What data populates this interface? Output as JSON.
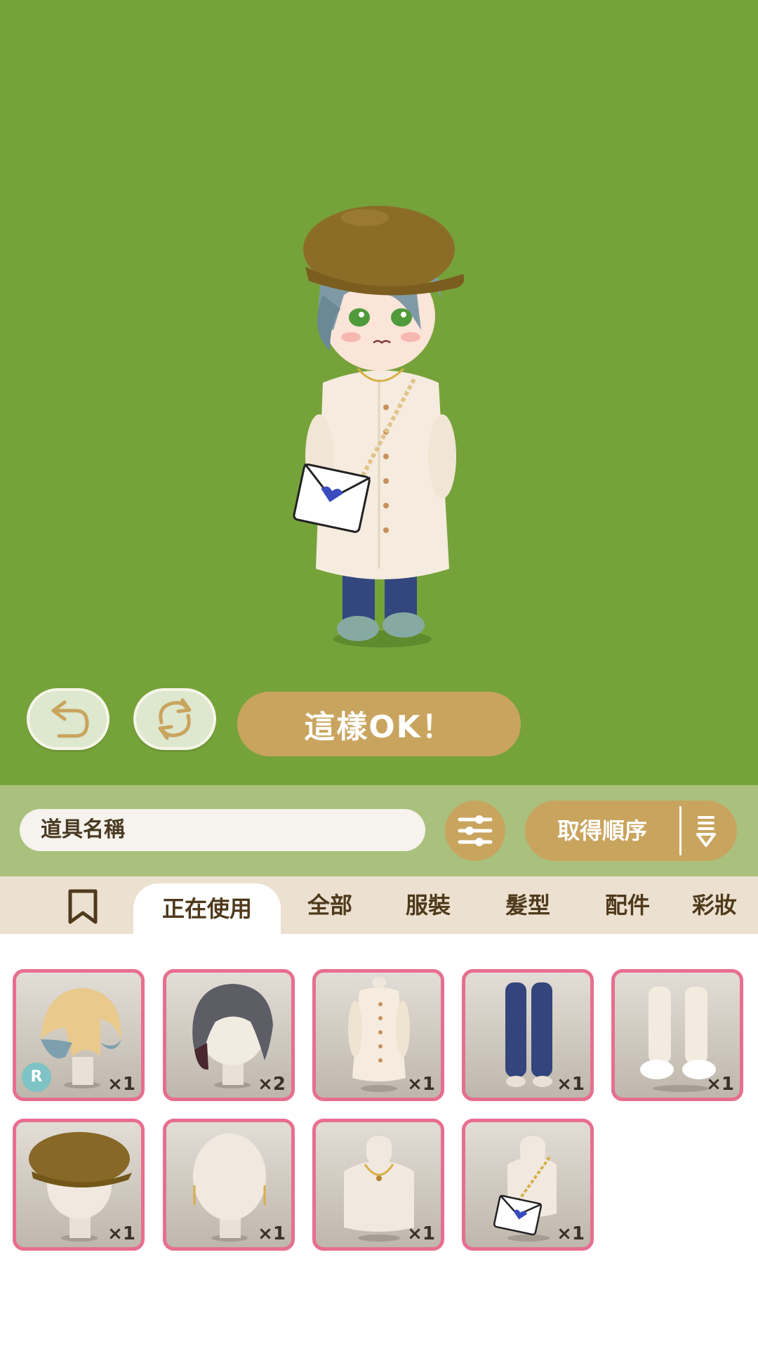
{
  "actions": {
    "ok_label": "這樣OK！"
  },
  "search": {
    "placeholder": "道具名稱"
  },
  "sort": {
    "label": "取得順序"
  },
  "tabs": [
    {
      "label": "正在使用",
      "active": true
    },
    {
      "label": "全部"
    },
    {
      "label": "服裝"
    },
    {
      "label": "髮型"
    },
    {
      "label": "配件"
    },
    {
      "label": "彩妝"
    }
  ],
  "items": [
    {
      "name": "gradient-hair",
      "count": "×1",
      "rarity": "R"
    },
    {
      "name": "dark-wavy-hair",
      "count": "×2"
    },
    {
      "name": "cream-long-coat",
      "count": "×1"
    },
    {
      "name": "denim-leggings",
      "count": "×1"
    },
    {
      "name": "white-socks-shoes",
      "count": "×1"
    },
    {
      "name": "brown-newsboy-cap",
      "count": "×1"
    },
    {
      "name": "gold-drop-earrings",
      "count": "×1"
    },
    {
      "name": "gold-necklace",
      "count": "×1"
    },
    {
      "name": "envelope-chain-bag",
      "count": "×1"
    }
  ],
  "colors": {
    "stage_bg": "#76a23a",
    "search_bar_bg": "#a9c17d",
    "tab_bar_bg": "#ece1d0",
    "gold": "#c9a45e",
    "item_border": "#e86e8f"
  }
}
